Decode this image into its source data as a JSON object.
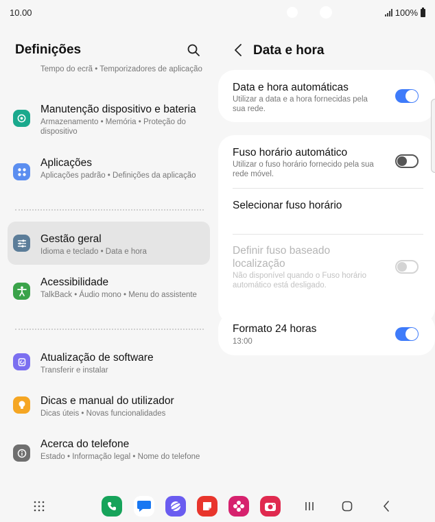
{
  "status_bar": {
    "time": "10.00",
    "battery": "100%"
  },
  "left_pane": {
    "title": "Definições",
    "clipped_item_sub": "Tempo do ecrã  •  Temporizadores de aplicação",
    "items": [
      {
        "title": "Manutenção dispositivo e bateria",
        "subtitle": "Armazenamento  •  Memória  •  Proteção do dispositivo",
        "icon": "device-care-icon",
        "color": "#1aa98d"
      },
      {
        "title": "Aplicações",
        "subtitle": "Aplicações padrão  •  Definições da aplicação",
        "icon": "apps-icon",
        "color": "#5b8ef0"
      },
      {
        "title": "Gestão geral",
        "subtitle": "Idioma e teclado  •  Data e hora",
        "icon": "sliders-icon",
        "color": "#5c7d99"
      },
      {
        "title": "Acessibilidade",
        "subtitle": "TalkBack  •  Áudio mono  •  Menu do assistente",
        "icon": "accessibility-icon",
        "color": "#3aa34a"
      },
      {
        "title": "Atualização de software",
        "subtitle": "Transferir e instalar",
        "icon": "software-update-icon",
        "color": "#7b6ff0"
      },
      {
        "title": "Dicas e manual do utilizador",
        "subtitle": "Dicas úteis  •  Novas funcionalidades",
        "icon": "lightbulb-icon",
        "color": "#f5a623"
      },
      {
        "title": "Acerca do telefone",
        "subtitle": "Estado  •  Informação legal  •  Nome do telefone",
        "icon": "info-icon",
        "color": "#6f6f6f"
      }
    ]
  },
  "right_pane": {
    "title": "Data e hora",
    "auto_datetime": {
      "title": "Data e hora automáticas",
      "subtitle": "Utilizar a data e a hora fornecidas pela sua rede.",
      "on": true
    },
    "auto_timezone": {
      "title": "Fuso horário automático",
      "subtitle": "Utilizar o fuso horário fornecido pela sua rede móvel.",
      "on": false
    },
    "select_timezone": {
      "title": "Selecionar fuso horário"
    },
    "location_timezone": {
      "title": "Definir fuso baseado localização",
      "subtitle": "Não disponível quando o Fuso horário automático está desligado.",
      "on": false,
      "disabled": true
    },
    "format_24h": {
      "title": "Formato 24 horas",
      "subtitle": "13:00",
      "on": true
    }
  },
  "colors": {
    "accent": "#3e7bfa",
    "active_bg": "#e5e5e5",
    "card_bg": "#ffffff",
    "page_bg": "#f6f6f6"
  }
}
